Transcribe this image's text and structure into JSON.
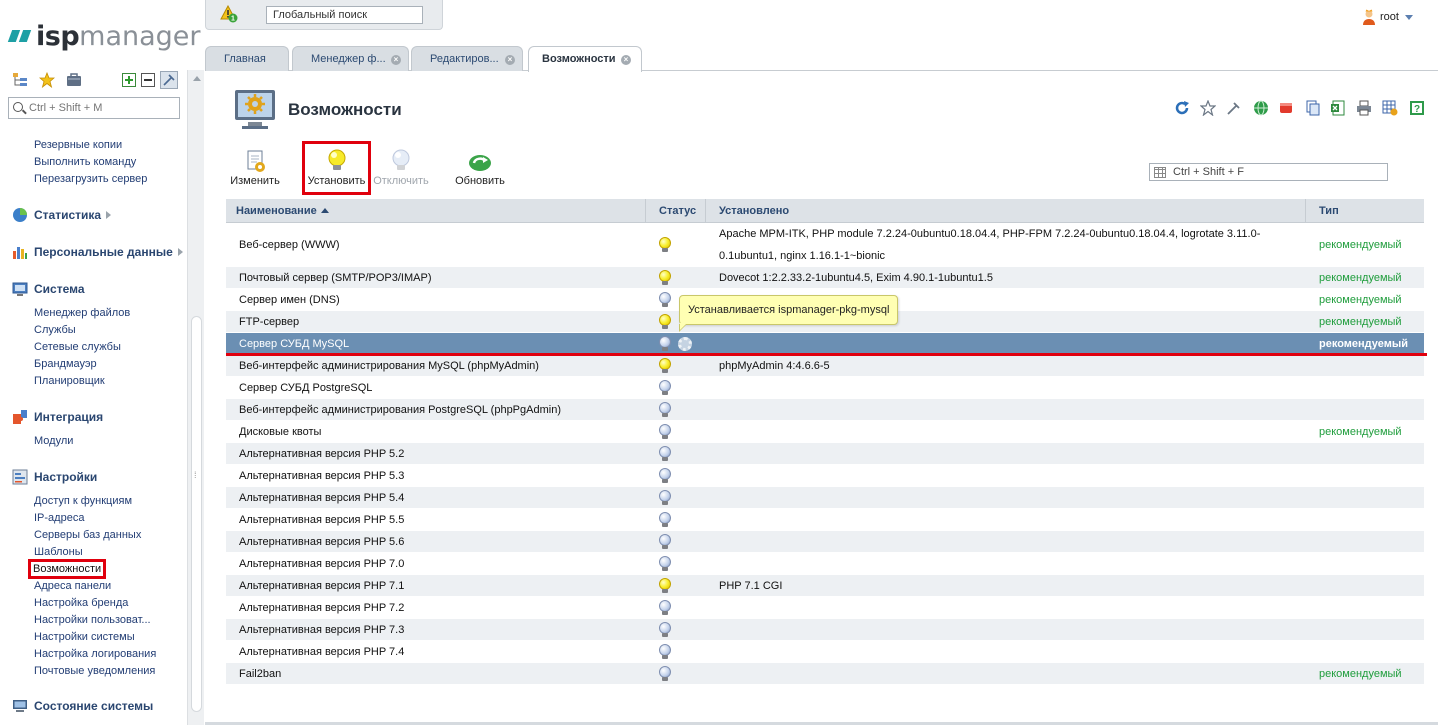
{
  "logo": {
    "brand_a": "isp",
    "brand_b": "manager"
  },
  "sidebar": {
    "search_placeholder": "Ctrl + Shift + M",
    "top_links": [
      "Резервные копии",
      "Выполнить команду",
      "Перезагрузить сервер"
    ],
    "categories": [
      {
        "label": "Статистика",
        "icon": "chart-pie-icon",
        "expandable": true,
        "items": []
      },
      {
        "label": "Персональные данные",
        "icon": "bar-chart-icon",
        "expandable": true,
        "items": []
      },
      {
        "label": "Система",
        "icon": "system-icon",
        "expandable": false,
        "items": [
          "Менеджер файлов",
          "Службы",
          "Сетевые службы",
          "Брандмауэр",
          "Планировщик"
        ]
      },
      {
        "label": "Интеграция",
        "icon": "puzzle-icon",
        "expandable": false,
        "items": [
          "Модули"
        ]
      },
      {
        "label": "Настройки",
        "icon": "settings-icon",
        "expandable": false,
        "items": [
          "Доступ к функциям",
          "IP-адреса",
          "Серверы баз данных",
          "Шаблоны",
          "Возможности",
          "Адреса панели",
          "Настройка бренда",
          "Настройки пользоват...",
          "Настройки системы",
          "Настройка логирования",
          "Почтовые уведомления"
        ]
      },
      {
        "label": "Состояние системы",
        "icon": "monitor-icon",
        "expandable": false,
        "items": []
      }
    ],
    "active_item": "Возможности"
  },
  "topbar": {
    "search_placeholder": "Глобальный поиск",
    "alert_count": "1",
    "user": "root"
  },
  "tabs": [
    {
      "label": "Главная",
      "closable": false,
      "active": false
    },
    {
      "label": "Менеджер ф...",
      "closable": true,
      "active": false
    },
    {
      "label": "Редактиров...",
      "closable": true,
      "active": false
    },
    {
      "label": "Возможности",
      "closable": true,
      "active": true
    }
  ],
  "page": {
    "title": "Возможности",
    "filter_placeholder": "Ctrl + Shift + F"
  },
  "toolbar": [
    {
      "label": "Изменить",
      "icon": "edit-icon",
      "disabled": false,
      "highlight": false
    },
    {
      "label": "Установить",
      "icon": "bulb-on-icon",
      "disabled": false,
      "highlight": true
    },
    {
      "label": "Отключить",
      "icon": "bulb-off-icon",
      "disabled": true,
      "highlight": false
    },
    {
      "label": "Обновить",
      "icon": "refresh-icon",
      "disabled": false,
      "highlight": false
    }
  ],
  "right_tools": [
    "reload-icon",
    "star-icon",
    "pin-icon",
    "globe-icon",
    "record-icon",
    "copy-icon",
    "excel-icon",
    "print-icon",
    "table-settings-icon",
    "help-icon"
  ],
  "grid": {
    "columns": [
      "Наименование",
      "Статус",
      "Установлено",
      "Тип"
    ],
    "rows": [
      {
        "name": "Веб-сервер (WWW)",
        "status": "on",
        "installed": "Apache MPM-ITK, PHP module 7.2.24-0ubuntu0.18.04.4, PHP-FPM 7.2.24-0ubuntu0.18.04.4, logrotate 3.11.0-0.1ubuntu1, nginx 1.16.1-1~bionic",
        "type": "рекомендуемый"
      },
      {
        "name": "Почтовый сервер (SMTP/POP3/IMAP)",
        "status": "on",
        "installed": "Dovecot 1:2.2.33.2-1ubuntu4.5, Exim 4.90.1-1ubuntu1.5",
        "type": "рекомендуемый"
      },
      {
        "name": "Сервер имен (DNS)",
        "status": "off",
        "installed": "",
        "type": "рекомендуемый"
      },
      {
        "name": "FTP-сервер",
        "status": "on",
        "installed": "",
        "type": "рекомендуемый"
      },
      {
        "name": "Сервер СУБД MySQL",
        "status": "off",
        "installed": "",
        "type": "рекомендуемый",
        "selected": true,
        "busy": true
      },
      {
        "name": "Веб-интерфейс администрирования MySQL (phpMyAdmin)",
        "status": "on",
        "installed": "phpMyAdmin 4:4.6.6-5",
        "type": ""
      },
      {
        "name": "Сервер СУБД PostgreSQL",
        "status": "off",
        "installed": "",
        "type": ""
      },
      {
        "name": "Веб-интерфейс администрирования PostgreSQL (phpPgAdmin)",
        "status": "off",
        "installed": "",
        "type": ""
      },
      {
        "name": "Дисковые квоты",
        "status": "off",
        "installed": "",
        "type": "рекомендуемый"
      },
      {
        "name": "Альтернативная версия PHP 5.2",
        "status": "off",
        "installed": "",
        "type": ""
      },
      {
        "name": "Альтернативная версия PHP 5.3",
        "status": "off",
        "installed": "",
        "type": ""
      },
      {
        "name": "Альтернативная версия PHP 5.4",
        "status": "off",
        "installed": "",
        "type": ""
      },
      {
        "name": "Альтернативная версия PHP 5.5",
        "status": "off",
        "installed": "",
        "type": ""
      },
      {
        "name": "Альтернативная версия PHP 5.6",
        "status": "off",
        "installed": "",
        "type": ""
      },
      {
        "name": "Альтернативная версия PHP 7.0",
        "status": "off",
        "installed": "",
        "type": ""
      },
      {
        "name": "Альтернативная версия PHP 7.1",
        "status": "on",
        "installed": "PHP 7.1 CGI",
        "type": ""
      },
      {
        "name": "Альтернативная версия PHP 7.2",
        "status": "off",
        "installed": "",
        "type": ""
      },
      {
        "name": "Альтернативная версия PHP 7.3",
        "status": "off",
        "installed": "",
        "type": ""
      },
      {
        "name": "Альтернативная версия PHP 7.4",
        "status": "off",
        "installed": "",
        "type": ""
      },
      {
        "name": "Fail2ban",
        "status": "off",
        "installed": "",
        "type": "рекомендуемый"
      }
    ]
  },
  "tooltip": "Устанавливается ispmanager-pkg-mysql",
  "colors": {
    "accent": "#6b8fb3",
    "recommended": "#1f9d3c",
    "highlight": "#e0000d",
    "link": "#223d74"
  }
}
